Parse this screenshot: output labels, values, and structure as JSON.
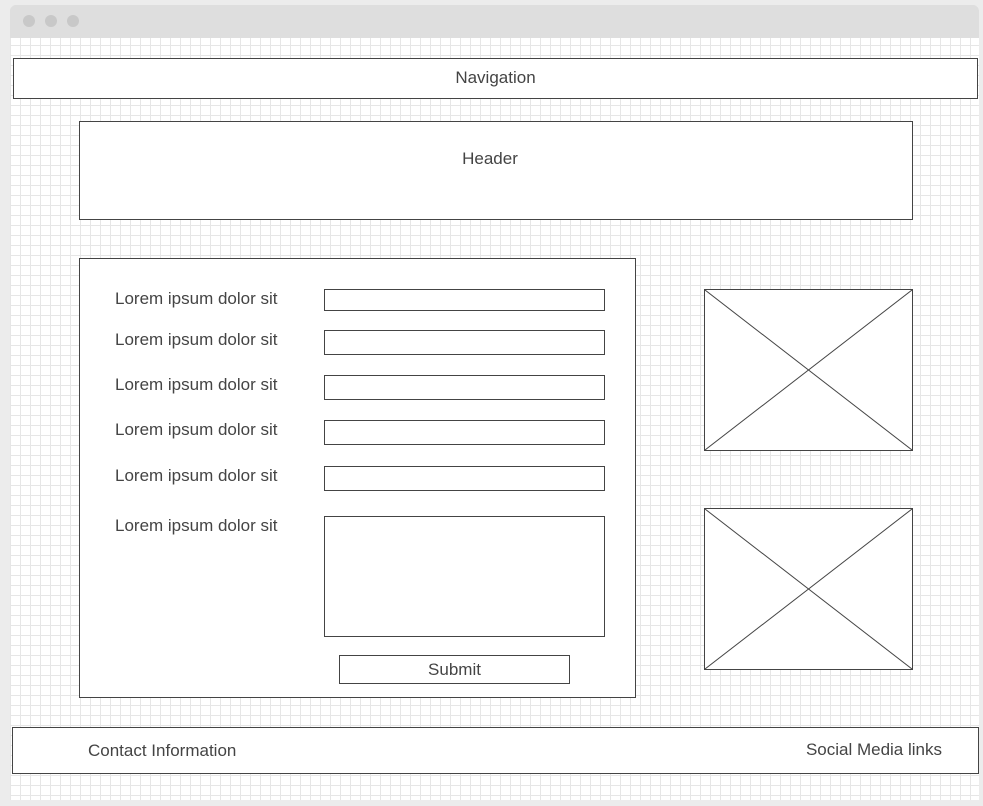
{
  "navigation": {
    "label": "Navigation"
  },
  "header": {
    "label": "Header"
  },
  "form": {
    "fields": [
      {
        "label": "Lorem ipsum dolor sit",
        "value": ""
      },
      {
        "label": "Lorem ipsum dolor sit",
        "value": ""
      },
      {
        "label": "Lorem ipsum dolor sit",
        "value": ""
      },
      {
        "label": "Lorem ipsum dolor sit",
        "value": ""
      },
      {
        "label": "Lorem ipsum dolor sit",
        "value": ""
      },
      {
        "label": "Lorem ipsum dolor sit",
        "value": ""
      }
    ],
    "submit_label": "Submit"
  },
  "footer": {
    "contact_label": "Contact Information",
    "social_label": "Social Media links"
  },
  "icons": {
    "image_placeholder": "image-placeholder-icon"
  }
}
